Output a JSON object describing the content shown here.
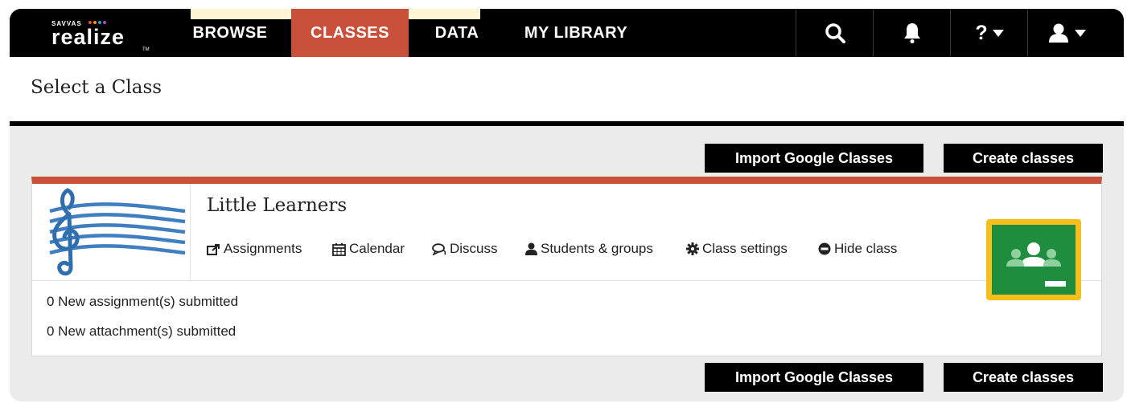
{
  "nav": {
    "logo_small": "SAVVAS",
    "logo_main": "realize",
    "logo_tm": "TM",
    "items": [
      {
        "label": "BROWSE"
      },
      {
        "label": "CLASSES"
      },
      {
        "label": "DATA"
      },
      {
        "label": "MY LIBRARY"
      }
    ],
    "active_index": 1,
    "help_label": "?",
    "icons": [
      "search-icon",
      "bell-icon",
      "help-dropdown-icon",
      "user-dropdown-icon"
    ]
  },
  "page": {
    "title": "Select a Class"
  },
  "buttons": {
    "import_label": "Import Google Classes",
    "create_label": "Create classes"
  },
  "class_card": {
    "name": "Little Learners",
    "actions": [
      {
        "label": "Assignments",
        "icon": "share-icon"
      },
      {
        "label": "Calendar",
        "icon": "calendar-icon"
      },
      {
        "label": "Discuss",
        "icon": "chat-icon"
      },
      {
        "label": "Students & groups",
        "icon": "user-icon"
      },
      {
        "label": "Class settings",
        "icon": "gear-icon"
      },
      {
        "label": "Hide class",
        "icon": "minus-circle-icon"
      }
    ],
    "stats": [
      "0 New assignment(s) submitted",
      "0 New attachment(s) submitted"
    ]
  },
  "colors": {
    "accent": "#c9503a",
    "topbar": "#000000",
    "background": "#ebebeb",
    "google_classroom_green": "#1e8e3e",
    "google_classroom_yellow": "#f7bf1c"
  }
}
